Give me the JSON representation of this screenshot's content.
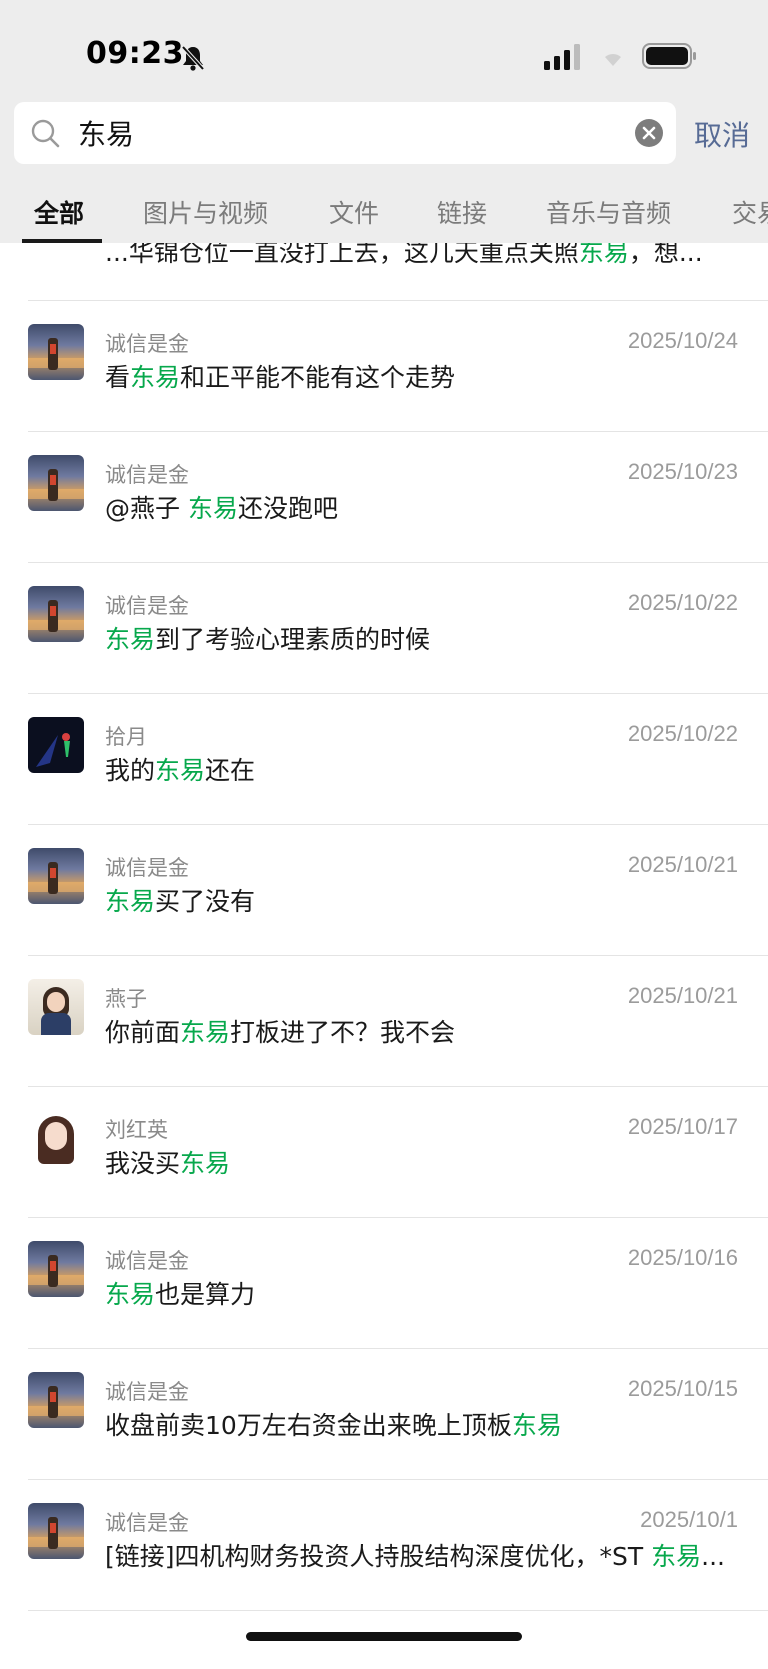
{
  "status_bar": {
    "time": "09:23"
  },
  "search": {
    "query": "东易",
    "cancel_label": "取消"
  },
  "tabs": [
    {
      "label": "全部",
      "active": true
    },
    {
      "label": "图片与视频"
    },
    {
      "label": "文件"
    },
    {
      "label": "链接"
    },
    {
      "label": "音乐与音频"
    },
    {
      "label": "交易"
    }
  ],
  "colors": {
    "highlight": "#07a84c",
    "cancel": "#576b95"
  },
  "partial_result": {
    "pre": "...华锦仓位一直没打上去，这几天重点关照",
    "hl": "东易",
    "post": "，想..."
  },
  "results": [
    {
      "name": "诚信是金",
      "date": "2025/10/24",
      "avatar": "landscape-avatar",
      "pre": "看",
      "hl": "东易",
      "post": "和正平能不能有这个走势"
    },
    {
      "name": "诚信是金",
      "date": "2025/10/23",
      "avatar": "landscape-avatar",
      "pre": "@燕子 ",
      "hl": "东易",
      "post": "还没跑吧"
    },
    {
      "name": "诚信是金",
      "date": "2025/10/22",
      "avatar": "landscape-avatar",
      "pre": "",
      "hl": "东易",
      "post": "到了考验心理素质的时候"
    },
    {
      "name": "拾月",
      "date": "2025/10/22",
      "avatar": "dark-figure-avatar",
      "pre": "我的",
      "hl": "东易",
      "post": "还在"
    },
    {
      "name": "诚信是金",
      "date": "2025/10/21",
      "avatar": "landscape-avatar",
      "pre": "",
      "hl": "东易",
      "post": "买了没有"
    },
    {
      "name": "燕子",
      "date": "2025/10/21",
      "avatar": "girl-photo-avatar",
      "pre": "你前面",
      "hl": "东易",
      "post": "打板进了不？我不会"
    },
    {
      "name": "刘红英",
      "date": "2025/10/17",
      "avatar": "cartoon-girl-avatar",
      "pre": "我没买",
      "hl": "东易",
      "post": ""
    },
    {
      "name": "诚信是金",
      "date": "2025/10/16",
      "avatar": "landscape-avatar",
      "pre": "",
      "hl": "东易",
      "post": "也是算力"
    },
    {
      "name": "诚信是金",
      "date": "2025/10/15",
      "avatar": "landscape-avatar",
      "pre": "收盘前卖10万左右资金出来晚上顶板",
      "hl": "东易",
      "post": ""
    },
    {
      "name": "诚信是金",
      "date": "2025/10/1",
      "avatar": "landscape-avatar",
      "pre": "[链接]四机构财务投资人持股结构深度优化，*ST ",
      "hl": "东易",
      "post": "..."
    }
  ]
}
